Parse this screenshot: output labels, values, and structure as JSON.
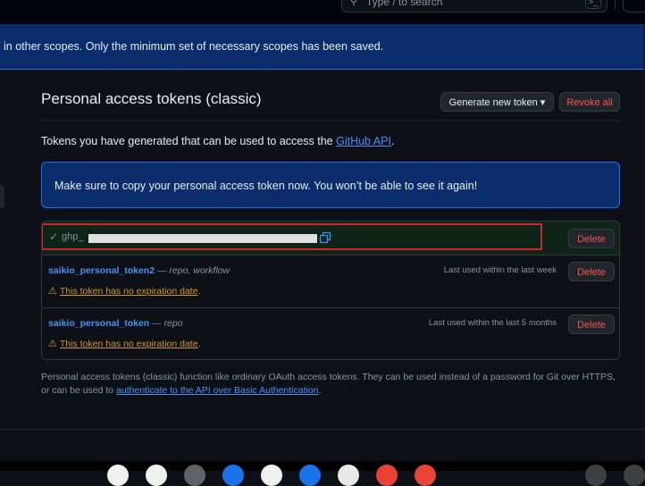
{
  "header": {
    "search_placeholder": "Type / to search",
    "search_icon": "search-icon",
    "command_icon": "command-palette-icon"
  },
  "flash": {
    "message": "in other scopes. Only the minimum set of necessary scopes has been saved."
  },
  "page": {
    "title": "Personal access tokens (classic)",
    "generate_label": "Generate new token ▾",
    "revoke_label": "Revoke all",
    "intro_prefix": "Tokens you have generated that can be used to access the ",
    "intro_link": "GitHub API",
    "intro_suffix": "."
  },
  "notice": {
    "message": "Make sure to copy your personal access token now. You won’t be able to see it again!"
  },
  "new_token": {
    "prefix": "ghp_",
    "check_icon": "check-icon",
    "copy_icon": "copy-icon",
    "delete_label": "Delete"
  },
  "tokens": [
    {
      "name": "saikio_personal_token2",
      "sep": " — ",
      "scopes": "repo, workflow",
      "last_used": "Last used within the last week",
      "warning": "This token has no expiration date",
      "warning_suffix": ".",
      "delete_label": "Delete"
    },
    {
      "name": "saikio_personal_token",
      "sep": " — ",
      "scopes": "repo",
      "last_used": "Last used within the last 5 months",
      "warning": "This token has no expiration date",
      "warning_suffix": ".",
      "delete_label": "Delete"
    }
  ],
  "footnote": {
    "text_prefix": "Personal access tokens (classic) function like ordinary OAuth access tokens. They can be used instead of a password for Git over HTTPS, or can be used to ",
    "link": "authenticate to the API over Basic Authentication",
    "text_suffix": "."
  },
  "colors": {
    "accent": "#4493f8",
    "danger": "#f85149",
    "warning": "#d29922",
    "success": "#3fb950",
    "highlight_box": "#d1242f"
  }
}
